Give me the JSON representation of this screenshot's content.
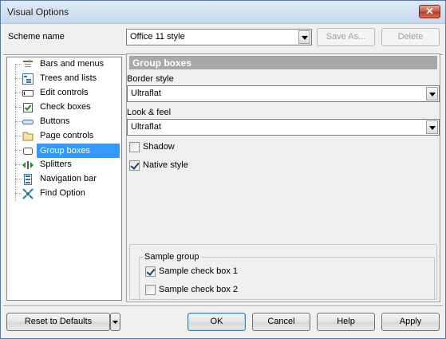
{
  "window": {
    "title": "Visual Options",
    "close_glyph": "✕"
  },
  "scheme": {
    "label": "Scheme name",
    "value": "Office 11 style",
    "save_as": "Save As...",
    "delete": "Delete"
  },
  "tree": {
    "items": [
      {
        "label": "Bars and menus",
        "icon": "bars-menus-icon"
      },
      {
        "label": "Trees and lists",
        "icon": "tree-list-icon"
      },
      {
        "label": "Edit controls",
        "icon": "edit-control-icon"
      },
      {
        "label": "Check boxes",
        "icon": "checkbox-icon"
      },
      {
        "label": "Buttons",
        "icon": "button-icon"
      },
      {
        "label": "Page controls",
        "icon": "folder-tab-icon"
      },
      {
        "label": "Group boxes",
        "icon": "group-box-icon",
        "selected": true
      },
      {
        "label": "Splitters",
        "icon": "splitter-icon"
      },
      {
        "label": "Navigation bar",
        "icon": "navigation-bar-icon"
      },
      {
        "label": "Find Option",
        "icon": "find-option-icon"
      }
    ]
  },
  "panel": {
    "header": "Group boxes",
    "border_style_label": "Border style",
    "border_style_value": "Ultraflat",
    "look_feel_label": "Look & feel",
    "look_feel_value": "Ultraflat",
    "shadow_label": "Shadow",
    "shadow_checked": false,
    "native_label": "Native style",
    "native_checked": true,
    "sample_group_title": "Sample group",
    "sample1_label": "Sample check box 1",
    "sample1_checked": true,
    "sample2_label": "Sample check box 2",
    "sample2_checked": false
  },
  "footer": {
    "reset": "Reset to Defaults",
    "ok": "OK",
    "cancel": "Cancel",
    "help": "Help",
    "apply": "Apply"
  }
}
